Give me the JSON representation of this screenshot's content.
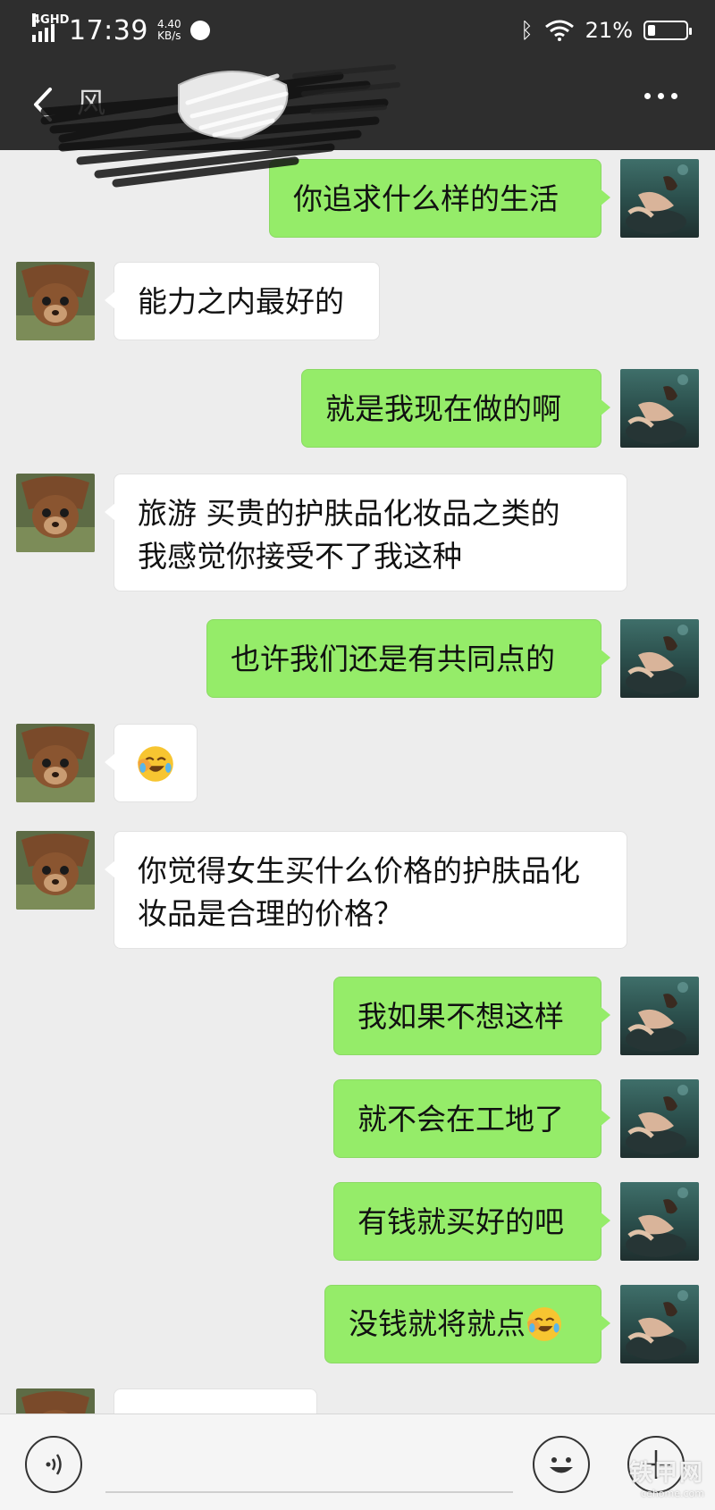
{
  "status_bar": {
    "network": "4GHD",
    "time": "17:39",
    "speed_value": "4.40",
    "speed_unit": "KB/s",
    "battery_pct": "21%",
    "battery_level": 0.21
  },
  "header": {
    "contact_name": "风"
  },
  "messages": [
    {
      "side": "me",
      "text": "你追求什么样的生活"
    },
    {
      "side": "them",
      "text": "能力之内最好的"
    },
    {
      "side": "me",
      "text": "就是我现在做的啊"
    },
    {
      "side": "them",
      "line1": "旅游 买贵的护肤品化妆品之类的",
      "line2": "我感觉你接受不了我这种"
    },
    {
      "side": "me",
      "text": "也许我们还是有共同点的"
    },
    {
      "side": "them",
      "emoji": "face-palm-crying-laughing"
    },
    {
      "side": "them",
      "line1": "你觉得女生买什么价格的护肤品化",
      "line2": "妆品是合理的价格？"
    },
    {
      "side": "me",
      "text": "我如果不想这样"
    },
    {
      "side": "me",
      "text": "就不会在工地了"
    },
    {
      "side": "me",
      "text": "有钱就买好的吧"
    },
    {
      "side": "me",
      "text": "没钱就将就点",
      "emoji": "face-palm-crying-laughing"
    },
    {
      "side": "them",
      "text": ""
    }
  ],
  "footer": {
    "voice_icon": "voice-icon",
    "emoji_icon": "smiley-icon",
    "plus_icon": "plus-icon"
  },
  "watermark": {
    "text": "铁甲网",
    "sub": "cehome.com"
  },
  "colors": {
    "header_bg": "#2e2e2e",
    "chat_bg": "#ededed",
    "my_bubble": "#95ec69",
    "their_bubble": "#ffffff"
  }
}
